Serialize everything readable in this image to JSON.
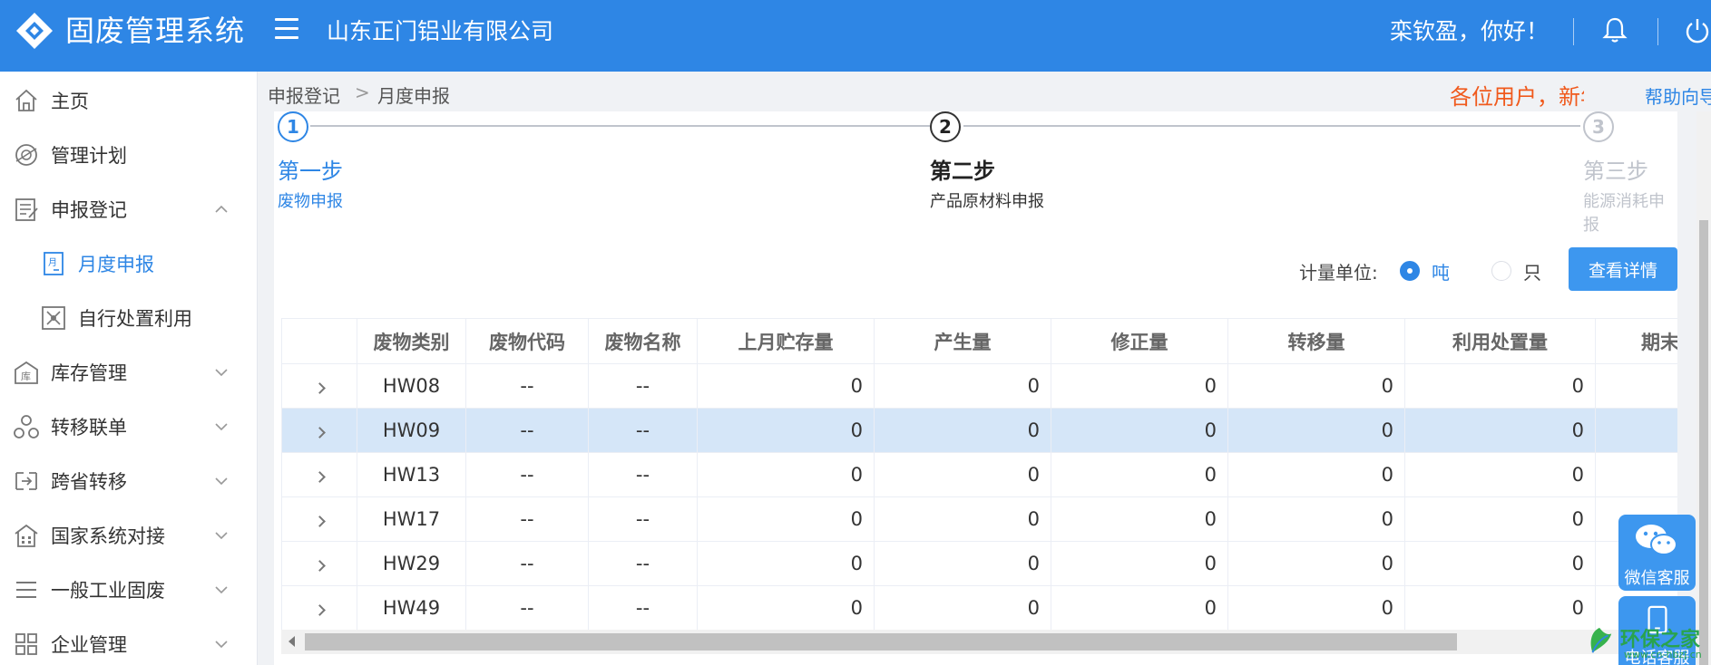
{
  "app": {
    "title": "固废管理系统",
    "company": "山东正门铝业有限公司",
    "greeting": "栾钦盈，你好！"
  },
  "sidebar": {
    "items": [
      {
        "label": "主页",
        "icon": "home-icon"
      },
      {
        "label": "管理计划",
        "icon": "plan-icon"
      },
      {
        "label": "申报登记",
        "icon": "register-icon"
      },
      {
        "label": "月度申报",
        "icon": "month-icon"
      },
      {
        "label": "自行处置利用",
        "icon": "dispose-icon"
      },
      {
        "label": "库存管理",
        "icon": "warehouse-icon"
      },
      {
        "label": "转移联单",
        "icon": "transfer-icon"
      },
      {
        "label": "跨省转移",
        "icon": "cross-province-icon"
      },
      {
        "label": "国家系统对接",
        "icon": "national-system-icon"
      },
      {
        "label": "一般工业固废",
        "icon": "list-icon"
      },
      {
        "label": "企业管理",
        "icon": "grid-icon"
      }
    ]
  },
  "breadcrumb": {
    "level1": "申报登记",
    "sep": ">",
    "level2": "月度申报"
  },
  "notice": {
    "text": "各位用户，新年快乐"
  },
  "help": {
    "label": "帮助向导"
  },
  "steps": [
    {
      "num": "1",
      "title": "第一步",
      "desc": "废物申报",
      "state": "done"
    },
    {
      "num": "2",
      "title": "第二步",
      "desc": "产品原材料申报",
      "state": "active"
    },
    {
      "num": "3",
      "title": "第三步",
      "desc": "能源消耗申报",
      "state": "pending"
    }
  ],
  "unit": {
    "label": "计量单位:",
    "options": [
      "吨",
      "只"
    ],
    "selected": "吨"
  },
  "detail_button": "查看详情",
  "table": {
    "columns": [
      "",
      "废物类别",
      "废物代码",
      "废物名称",
      "上月贮存量",
      "产生量",
      "修正量",
      "转移量",
      "利用处置量",
      "期末贮存量"
    ],
    "rows": [
      {
        "cells": [
          "HW08",
          "--",
          "--",
          "0",
          "0",
          "0",
          "0",
          "0",
          ""
        ],
        "highlighted": false
      },
      {
        "cells": [
          "HW09",
          "--",
          "--",
          "0",
          "0",
          "0",
          "0",
          "0",
          ""
        ],
        "highlighted": true
      },
      {
        "cells": [
          "HW13",
          "--",
          "--",
          "0",
          "0",
          "0",
          "0",
          "0",
          ""
        ],
        "highlighted": false
      },
      {
        "cells": [
          "HW17",
          "--",
          "--",
          "0",
          "0",
          "0",
          "0",
          "0",
          ""
        ],
        "highlighted": false
      },
      {
        "cells": [
          "HW29",
          "--",
          "--",
          "0",
          "0",
          "0",
          "0",
          "0",
          ""
        ],
        "highlighted": false
      },
      {
        "cells": [
          "HW49",
          "--",
          "--",
          "0",
          "0",
          "0",
          "0",
          "0",
          ""
        ],
        "highlighted": false
      }
    ]
  },
  "float": {
    "wechat": "微信客服",
    "phone": "电话客服"
  },
  "watermark": {
    "text": "环保之家",
    "sub": "www.cn-hbzj.cn"
  },
  "colors": {
    "primary": "#2e86e5",
    "notice": "#f05a1d",
    "highlight_row": "#d5e6f8"
  }
}
